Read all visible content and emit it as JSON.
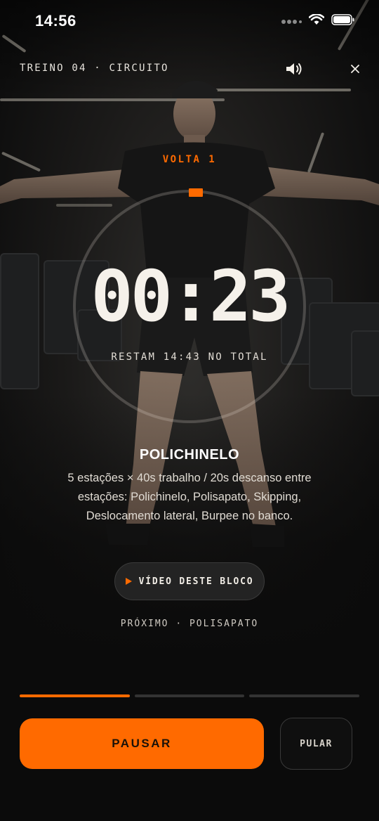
{
  "status_bar": {
    "time": "14:56"
  },
  "header": {
    "title": "TREINO 04 · CIRCUITO"
  },
  "timer": {
    "round_label": "VOLTA 1",
    "time_display": "00:23",
    "remaining_label": "RESTAM 14:43 NO TOTAL",
    "ring_progress": 0.0
  },
  "exercise": {
    "name": "POLICHINELO",
    "description": "5 estações × 40s trabalho / 20s descanso entre estações: Polichinelo, Polisapato, Skipping, Deslocamento lateral, Burpee no banco."
  },
  "video_button": {
    "label": "VÍDEO DESTE BLOCO",
    "icon": "play-icon"
  },
  "next": {
    "label": "PRÓXIMO · POLISAPATO"
  },
  "progress": {
    "segments": 3,
    "completed": 1
  },
  "actions": {
    "pause_label": "PAUSAR",
    "skip_label": "PULAR"
  },
  "colors": {
    "accent": "#ff6a00",
    "background": "#0b0b0b",
    "text": "#f3efe8"
  }
}
